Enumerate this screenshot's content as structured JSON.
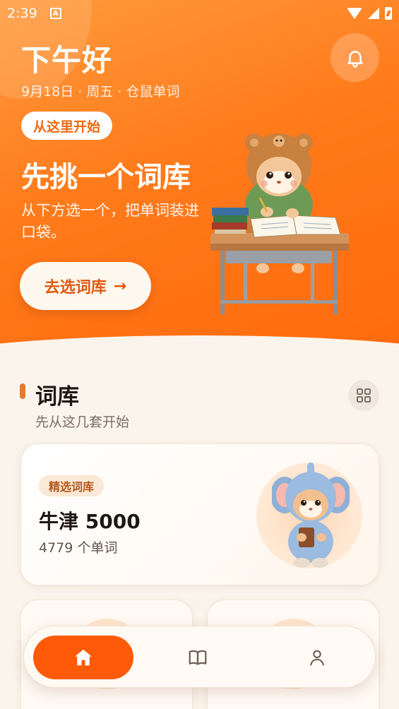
{
  "status_bar": {
    "time": "2:39",
    "app_badge": "A"
  },
  "header": {
    "greeting": "下午好",
    "date_line": "9月18日 · 周五 · 仓鼠单词"
  },
  "hero": {
    "start_pill": "从这里开始",
    "title": "先挑一个词库",
    "subtitle": "从下方选一个，把单词装进口袋。",
    "cta_label": "去选词库",
    "cta_arrow": "→"
  },
  "section": {
    "title": "词库",
    "subtitle": "先从这几套开始"
  },
  "featured_card": {
    "badge": "精选词库",
    "title": "牛津 5000",
    "word_count": "4779 个单词"
  },
  "colors": {
    "accent": "#ff6a0e",
    "hero_gradient_start": "#ff9a3c",
    "background": "#fbf4ec",
    "nav_active": "#ff5a0a"
  },
  "icons": {
    "bell": "bell-icon",
    "grid": "grid-icon",
    "home": "home-icon",
    "book": "book-icon",
    "user": "user-icon"
  }
}
